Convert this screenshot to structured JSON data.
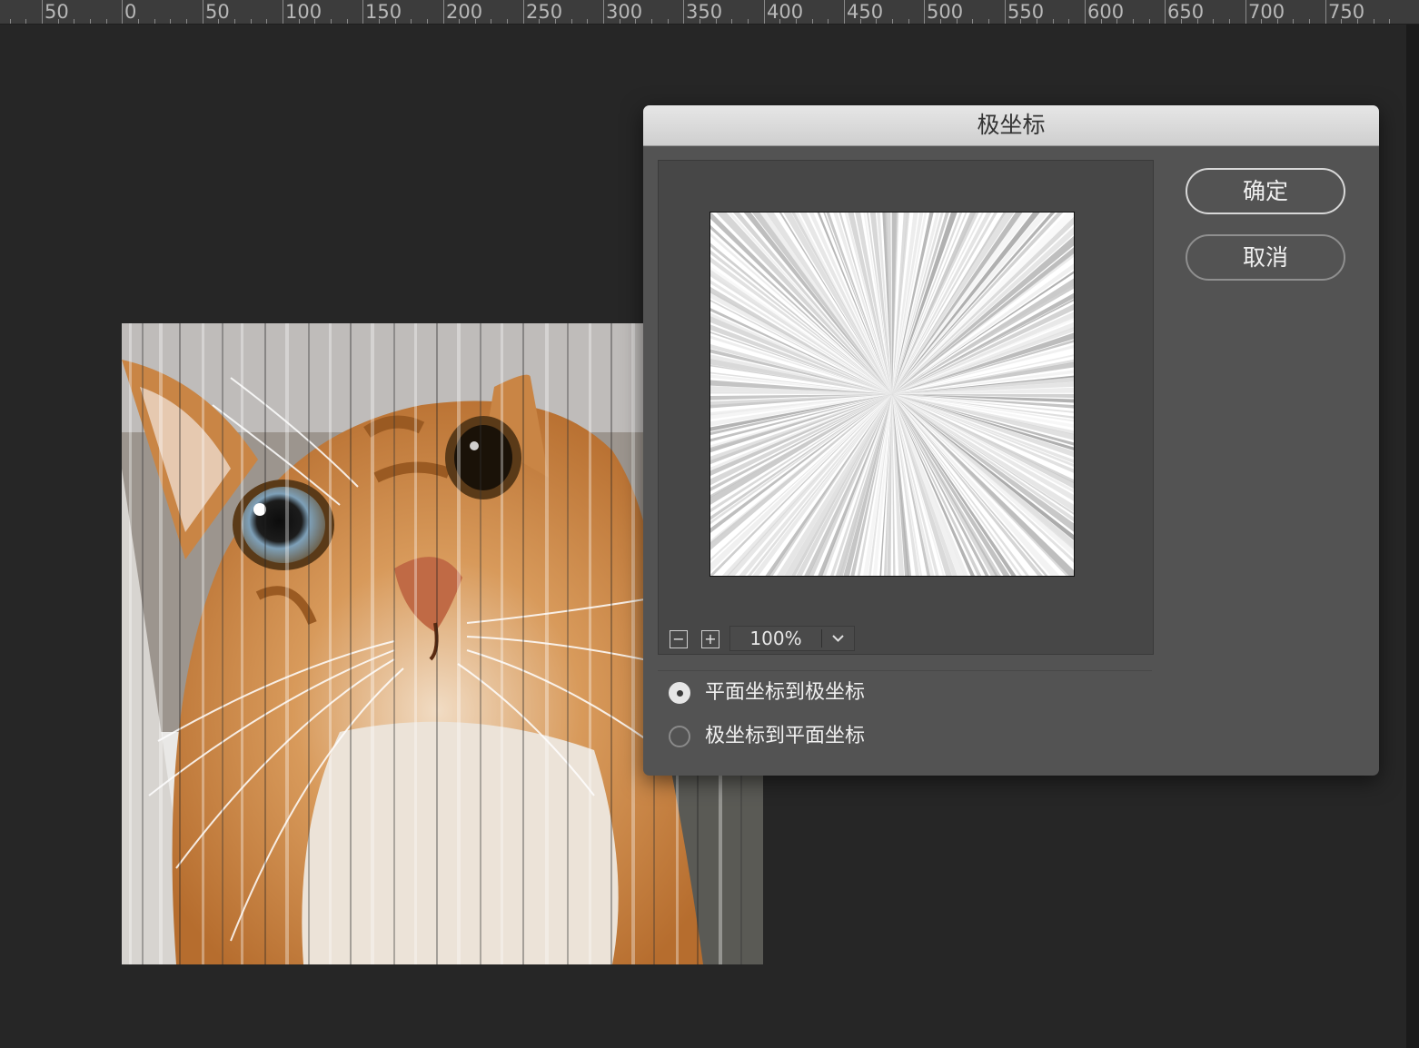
{
  "ruler": {
    "labels": [
      "50",
      "0",
      "50",
      "100",
      "150",
      "200",
      "250",
      "300",
      "350",
      "400",
      "450",
      "500",
      "550",
      "600",
      "650",
      "700",
      "750"
    ]
  },
  "dialog": {
    "title": "极坐标",
    "ok_label": "确定",
    "cancel_label": "取消",
    "zoom": {
      "value": "100%",
      "minus_symbol": "−",
      "plus_symbol": "+"
    },
    "options": [
      {
        "label": "平面坐标到极坐标",
        "checked": true
      },
      {
        "label": "极坐标到平面坐标",
        "checked": false
      }
    ]
  }
}
